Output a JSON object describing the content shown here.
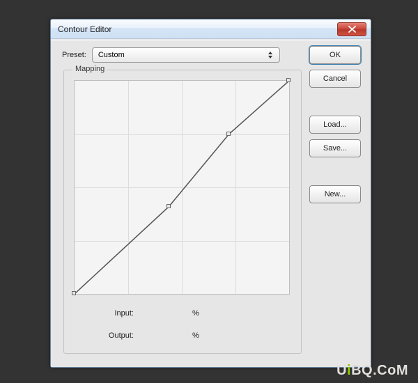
{
  "window": {
    "title": "Contour Editor",
    "close_icon": "close"
  },
  "preset": {
    "label": "Preset:",
    "value": "Custom"
  },
  "mapping": {
    "label": "Mapping",
    "input_label": "Input:",
    "output_label": "Output:",
    "percent": "%",
    "points": [
      {
        "x": 0,
        "y": 0
      },
      {
        "x": 44,
        "y": 41
      },
      {
        "x": 72,
        "y": 75
      },
      {
        "x": 100,
        "y": 100
      }
    ]
  },
  "buttons": {
    "ok": "OK",
    "cancel": "Cancel",
    "load": "Load...",
    "save": "Save...",
    "new": "New..."
  },
  "watermark": {
    "pre": "U",
    "i": "i",
    "post": "BQ.CoM"
  },
  "chart_data": {
    "type": "line",
    "title": "Mapping",
    "xlabel": "Input",
    "ylabel": "Output",
    "x": [
      0,
      44,
      72,
      100
    ],
    "values": [
      0,
      41,
      75,
      100
    ],
    "xlim": [
      0,
      100
    ],
    "ylim": [
      0,
      100
    ]
  }
}
